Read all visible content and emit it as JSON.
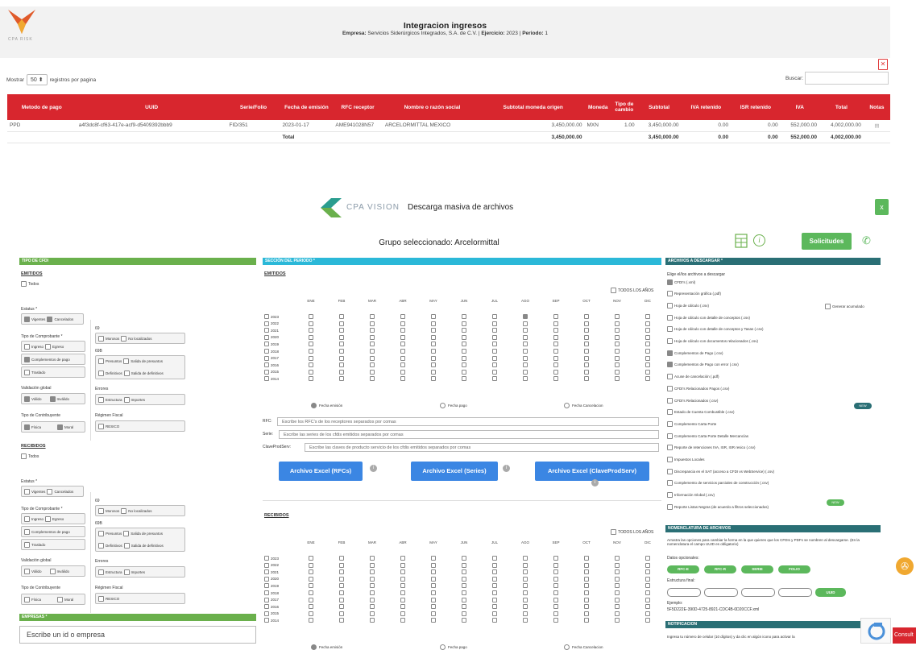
{
  "report": {
    "logo_caption": "CPA RISK",
    "title": "Integracion ingresos",
    "sub_empresa_label": "Empresa:",
    "sub_empresa": "Servicios Siderúrgicos Integrados, S.A. de C.V.",
    "sub_sep1": "|",
    "sub_ejercicio_label": "Ejercicio:",
    "sub_ejercicio": "2023",
    "sub_sep2": "|",
    "sub_periodo_label": "Periodo:",
    "sub_periodo": "1",
    "show_label": "Mostrar",
    "show_value": "50",
    "show_suffix": "registros por pagina",
    "search_label": "Buscar:",
    "columns": [
      "Metodo de pago",
      "UUID",
      "Serie/Folio",
      "Fecha de emisión",
      "RFC receptor",
      "Nombre o razón social",
      "Subtotal moneda origen",
      "Moneda",
      "Tipo de cambio",
      "Subtotal",
      "IVA retenido",
      "ISR retenido",
      "IVA",
      "Total",
      "Notas"
    ],
    "row": [
      "PPD",
      "a4f3dc8f-cf63-417e-acf9-d5409392bbb9",
      "FID/351",
      "2023-01-17",
      "AME941028N57",
      "ARCELORMITTAL MEXICO",
      "3,450,000.00",
      "MXN",
      "1.00",
      "3,450,000.00",
      "0.00",
      "0.00",
      "552,000.00",
      "4,002,000.00"
    ],
    "total": {
      "label": "Total",
      "subtotal_origen": "3,450,000.00",
      "subtotal": "3,450,000.00",
      "iva_ret": "0.00",
      "isr_ret": "0.00",
      "iva": "552,000.00",
      "total": "4,002,000.00"
    }
  },
  "modal": {
    "brand": "CPA VISION",
    "title": "Descarga masiva de archivos",
    "close": "x",
    "group_title": "Grupo seleccionado: Arcelormittal",
    "solicitudes": "Solicitudes",
    "tipo": {
      "header": "TIPO DE CFDI",
      "emitidos": "EMITIDOS",
      "recibidos": "RECIBIDOS",
      "todos": "Todos",
      "estatus": "Estatus *",
      "vigentes": "Vigentes",
      "cancelados": "Cancelados",
      "tipo_comp": "Tipo de Comprobante *",
      "ingreso": "Ingreso",
      "egreso": "Egreso",
      "complementos": "Complementos de pago",
      "traslado": "Traslado",
      "validacion": "Validación global",
      "valido": "Válido",
      "invalido": "Inválido",
      "tipo_contrib": "Tipo de Contribuyente",
      "fisica": "Física",
      "moral": "Moral",
      "col69": "69",
      "morosos": "Morosos",
      "no_localizados": "No localizados",
      "col69b": "69B",
      "presuntos": "Presuntos",
      "salida_presuntos": "Salida de presuntos",
      "definitivos": "Definitivos",
      "salida_definitivos": "Salida de definitivos",
      "errores": "Errores",
      "estructura": "Estructura",
      "importes": "Importes",
      "regimen": "Régimen Fiscal",
      "resico": "RESICO"
    },
    "empresas": {
      "header": "EMPRESAS *",
      "placeholder": "Escribe un id o empresa"
    },
    "periodo": {
      "header": "SECCIÓN DEL PERIODO *",
      "emitidos": "EMITIDOS",
      "recibidos": "RECIBIDOS",
      "todos_anios": "TODOS LOS AÑOS",
      "months": [
        "ENE",
        "FEB",
        "MAR",
        "ABR",
        "MAY",
        "JUN",
        "JUL",
        "AGO",
        "SEP",
        "OCT",
        "NOV",
        "DIC"
      ],
      "years": [
        "2023",
        "2022",
        "2021",
        "2020",
        "2019",
        "2018",
        "2017",
        "2016",
        "2015",
        "2014"
      ],
      "checked_emitidos": [
        [
          0,
          7
        ]
      ],
      "fecha_emision": "Fecha emisión",
      "fecha_pago": "Fecha pago",
      "fecha_cancel": "Fecha Cancelacion",
      "rfc_label": "RFC:",
      "rfc_ph": "Escribe los RFC's de los receptores separados por comas",
      "serie_label": "Serie:",
      "serie_ph": "Escribe las series de los cfdis emitidos separados por comas",
      "clave_label": "ClaveProdServ:",
      "clave_ph": "Escribe las claves de producto servicio de los cfdis emitidos separados por comas",
      "btn_rfc": "Archivo Excel (RFCs)",
      "btn_series": "Archivo Excel (Series)",
      "btn_clave": "Archivo Excel (ClaveProdServ)",
      "info": "i"
    },
    "archivos": {
      "header": "ARCHIVOS A DESCARGAR *",
      "intro": "Elige el/los archivos a descargar",
      "items": [
        {
          "label": "CFDI's (.xml)",
          "on": true
        },
        {
          "label": "Representación gráfica (.pdf)",
          "on": false
        },
        {
          "label": "Hoja de cálculo (.csv)",
          "on": false
        },
        {
          "label": "Hoja de cálculo con detalle de conceptos (.csv)",
          "on": false
        },
        {
          "label": "Hoja de cálculo con detalle de conceptos y Tasas (.csv)",
          "on": false
        },
        {
          "label": "Hoja de cálculo con documentos relacionados (.csv)",
          "on": false
        },
        {
          "label": "Complementos de Pago (.csv)",
          "on": true
        },
        {
          "label": "Complementos de Pago con error (.csv)",
          "on": true
        },
        {
          "label": "Acuse de cancelación (.pdf)",
          "on": false
        },
        {
          "label": "CFDI's Relacionados Pagos (.csv)",
          "on": false
        },
        {
          "label": "CFDI's Relacionados (.csv)",
          "on": false
        },
        {
          "label": "Estado de Cuenta Combustible (.csv)",
          "on": false
        },
        {
          "label": "Complemento Carta Porte",
          "on": false
        },
        {
          "label": "Complemento Carta Porte Detalle Mercancías",
          "on": false
        },
        {
          "label": "Reporte de retenciones IVA, ISR, ISR resico (.csv)",
          "on": false
        },
        {
          "label": "Impuestos Locales",
          "on": false
        },
        {
          "label": "Discrepancia en el SAT (acceso a CFDI vs WebService) (.csv)",
          "on": false
        },
        {
          "label": "Complemento de servicios parciales de construcción (.csv)",
          "on": false
        },
        {
          "label": "Información Global (.csv)",
          "on": false
        },
        {
          "label": "Reporte Listas Negras (de acuerdo a filtros seleccionados)",
          "on": false
        }
      ],
      "generar": "Generar acumulado",
      "new1": "NEW",
      "new2": "NEW"
    },
    "nomen": {
      "header": "NOMENCLATURA DE ARCHIVOS",
      "desc": "Arrastra las opciones para cambiar la forma en la que quieres que los CFDIs y PDFs se nombren al descargarse. (En la nomenclatura el campo UUID es obligatorio)",
      "datos": "Datos opcionales:",
      "opts": [
        "RFC-E",
        "RFC-R",
        "SERIE",
        "FOLIO"
      ],
      "estructura": "Estructura final:",
      "uuid": "UUID",
      "ejemplo": "Ejemplo:",
      "ejemplo_val": "5F5D222E-390D-4725-8921-CDC4B-0D20CCF.xml"
    },
    "notif": {
      "header": "NOTIFICACION",
      "text": "Ingresa tu número de celular (10 dígitos) y da clic en algún icono para activar la"
    }
  },
  "consult": "Consult"
}
